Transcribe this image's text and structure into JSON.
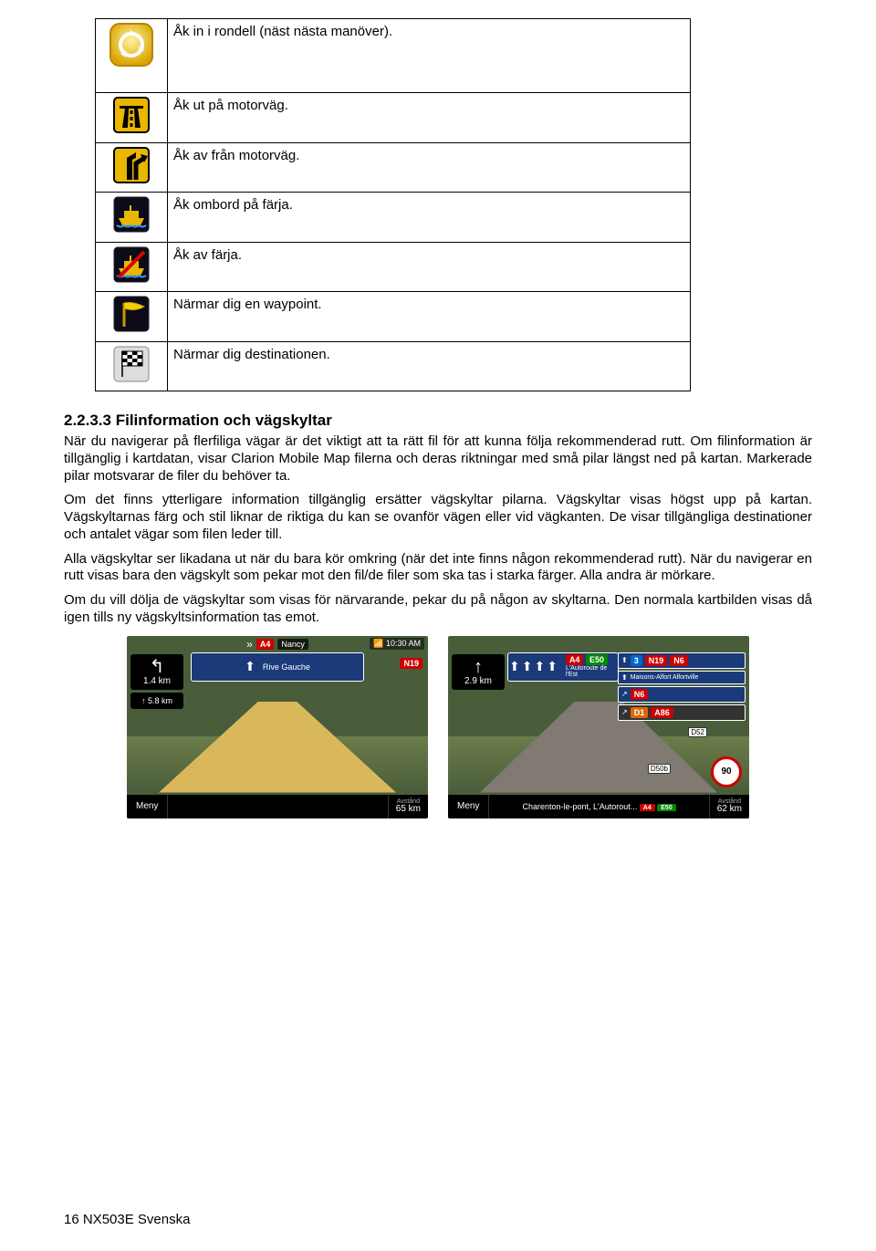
{
  "icon_rows": [
    {
      "text": "Åk in i rondell (näst nästa manöver)."
    },
    {
      "text": "Åk ut på motorväg."
    },
    {
      "text": "Åk av från motorväg."
    },
    {
      "text": "Åk ombord på färja."
    },
    {
      "text": "Åk av färja."
    },
    {
      "text": "Närmar dig en waypoint."
    },
    {
      "text": "Närmar dig destinationen."
    }
  ],
  "section_heading": "2.2.3.3 Filinformation och vägskyltar",
  "paragraphs": {
    "p1": "När du navigerar på flerfiliga vägar är det viktigt att ta rätt fil för att kunna följa rekommenderad rutt. Om filinformation är tillgänglig i kartdatan, visar Clarion Mobile Map filerna och deras riktningar med små pilar längst ned på kartan. Markerade pilar motsvarar de filer du behöver ta.",
    "p2": "Om det finns ytterligare information tillgänglig ersätter vägskyltar pilarna. Vägskyltar visas högst upp på kartan. Vägskyltarnas färg och stil liknar de riktiga du kan se ovanför vägen eller vid vägkanten. De visar tillgängliga destinationer och antalet vägar som filen leder till.",
    "p3": "Alla vägskyltar ser likadana ut när du bara kör omkring (när det inte finns någon rekommenderad rutt). När du navigerar en rutt visas bara den vägskylt som pekar mot den fil/de filer som ska tas i starka färger. Alla andra är mörkare.",
    "p4": "Om du vill dölja de vägskyltar som visas för närvarande, pekar du på någon av skyltarna. Den normala kartbilden visas då igen tills ny vägskyltsinformation tas emot."
  },
  "screenshot1": {
    "top_route": "A4",
    "top_dest": "Nancy",
    "time": "10:30 AM",
    "road_badge": "N19",
    "next_turn_dist": "1.4 km",
    "next2_dist": "5.8 km",
    "sign_text": "Rive Gauche",
    "menu": "Meny",
    "dist_label": "Avstånd",
    "dist_value": "65 km",
    "speed": ""
  },
  "screenshot2": {
    "top_routes": [
      "A4",
      "E50"
    ],
    "top_dest": "L'Autoroute de l'Est",
    "extra_routes": [
      "3",
      "N19",
      "N6"
    ],
    "extra_dest": "Maisons-Alfort  Alfortville",
    "n6_badge": "N6",
    "d1_badge": "D1",
    "a86_badge": "A86",
    "next_turn_dist": "2.9 km",
    "street1": "D52",
    "street2": "D50b",
    "menu": "Meny",
    "center": "Charenton-le-pont, L'Autorout...",
    "center_badges": [
      "A4",
      "E50"
    ],
    "dist_label": "Avstånd",
    "dist_value": "62 km",
    "speed": "90"
  },
  "footer": "16 NX503E Svenska"
}
